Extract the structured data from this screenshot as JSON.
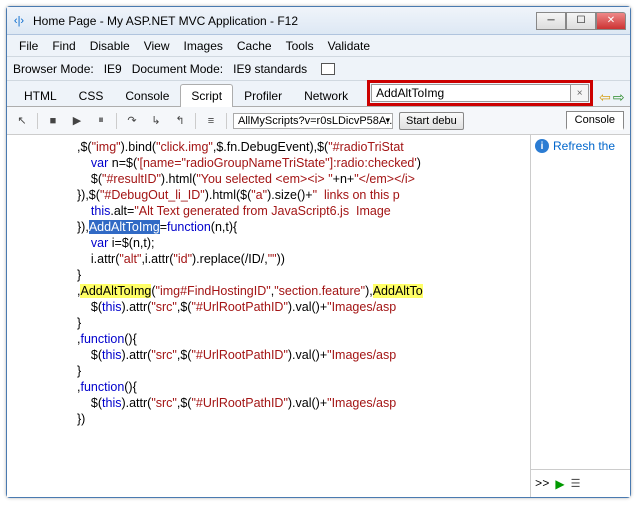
{
  "window": {
    "title": "Home Page - My ASP.NET MVC Application - F12",
    "icon_glyph": "‹|›"
  },
  "menu": [
    "File",
    "Find",
    "Disable",
    "View",
    "Images",
    "Cache",
    "Tools",
    "Validate"
  ],
  "mode": {
    "browser_label": "Browser Mode:",
    "browser_value": "IE9",
    "doc_label": "Document Mode:",
    "doc_value": "IE9 standards"
  },
  "tabs": [
    "HTML",
    "CSS",
    "Console",
    "Script",
    "Profiler",
    "Network"
  ],
  "active_tab": "Script",
  "search": {
    "value": "AddAltToImg",
    "clear_glyph": "×"
  },
  "nav": {
    "prev": "⇦",
    "next": "⇨",
    "prev_color": "#d4a017",
    "next_color": "#2a8a2a"
  },
  "toolbar": {
    "cursor": "↖",
    "stop": "■",
    "play": "▶",
    "pause": "⏸",
    "step1": "↷",
    "step2": "↳",
    "step3": "↰",
    "format": "≡",
    "script_selector": "AllMyScripts?v=r0sLDicvP58A...",
    "start_debug": "Start debu",
    "console_label": "Console"
  },
  "right": {
    "refresh_msg": "Refresh the",
    "prompt": ">>",
    "run": "▶",
    "multi": "☰"
  },
  "code": {
    "l1a": ",$(",
    "l1b": "\"img\"",
    "l1c": ").bind(",
    "l1d": "\"click.img\"",
    "l1e": ",$.fn.DebugEvent),$(",
    "l1f": "\"#radioTriStat",
    "l2a": "    ",
    "l2kw": "var",
    "l2b": " n=$(",
    "l2c": "'[name=\"radioGroupNameTriState\"]:radio:checked'",
    "l2d": ")",
    "l3a": "    $(",
    "l3b": "\"#resultID\"",
    "l3c": ").html(",
    "l3d": "\"You selected <em><i> \"",
    "l3e": "+n+",
    "l3f": "\"</em></i>",
    "l4a": "}),$(",
    "l4b": "\"#DebugOut_li_ID\"",
    "l4c": ").html($(",
    "l4d": "\"a\"",
    "l4e": ").size()+",
    "l4f": "\"  links on this p",
    "l5a": "    ",
    "l5kw": "this",
    "l5b": ".alt=",
    "l5c": "\"Alt Text generated from JavaScript6.js  Image ",
    "l6a": "}),",
    "l6hl": "AddAltToImg",
    "l6b": "=",
    "l6kw": "function",
    "l6c": "(n,t){",
    "l7a": "    ",
    "l7kw": "var",
    "l7b": " i=$(n,t);",
    "l8a": "    i.attr(",
    "l8b": "\"alt\"",
    "l8c": ",i.attr(",
    "l8d": "\"id\"",
    "l8e": ").replace(",
    "l8f": "/ID/",
    "l8g": ",",
    "l8h": "\"\"",
    "l8i": "))",
    "l9a": "}",
    "l10a": ",",
    "l10hl": "AddAltToImg",
    "l10b": "(",
    "l10c": "\"img#FindHostingID\"",
    "l10d": ",",
    "l10e": "\"section.feature\"",
    "l10f": "),",
    "l10hl2": "AddAltTo",
    "l11a": "    $(",
    "l11kw": "this",
    "l11b": ").attr(",
    "l11c": "\"src\"",
    "l11d": ",$(",
    "l11e": "\"#UrlRootPathID\"",
    "l11f": ").val()+",
    "l11g": "\"Images/asp",
    "l12a": "}",
    "l13a": ",",
    "l13kw": "function",
    "l13b": "(){",
    "l14a": "    $(",
    "l14kw": "this",
    "l14b": ").attr(",
    "l14c": "\"src\"",
    "l14d": ",$(",
    "l14e": "\"#UrlRootPathID\"",
    "l14f": ").val()+",
    "l14g": "\"Images/asp",
    "l15a": "}",
    "l16a": ",",
    "l16kw": "function",
    "l16b": "(){",
    "l17a": "    $(",
    "l17kw": "this",
    "l17b": ").attr(",
    "l17c": "\"src\"",
    "l17d": ",$(",
    "l17e": "\"#UrlRootPathID\"",
    "l17f": ").val()+",
    "l17g": "\"Images/asp",
    "l18a": "})"
  }
}
